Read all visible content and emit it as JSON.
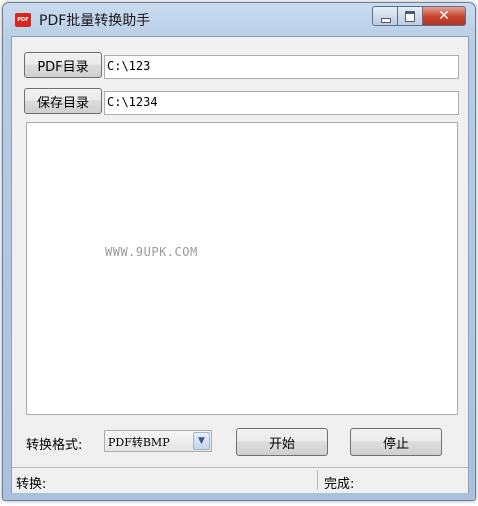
{
  "window": {
    "title": "PDF批量转换助手",
    "icon": "pdf-app-icon",
    "icon_text": "PDF"
  },
  "caption_buttons": {
    "close_glyph": "✕"
  },
  "pdf_dir": {
    "button_label": "PDF目录",
    "value": "C:\\123"
  },
  "save_dir": {
    "button_label": "保存目录",
    "value": "C:\\1234"
  },
  "log_area": {
    "watermark": "WWW.9UPK.COM"
  },
  "format": {
    "label": "转换格式:",
    "selected": "PDF转BMP"
  },
  "actions": {
    "start_label": "开始",
    "stop_label": "停止"
  },
  "status": {
    "converting_label": "转换:",
    "done_label": "完成:"
  }
}
